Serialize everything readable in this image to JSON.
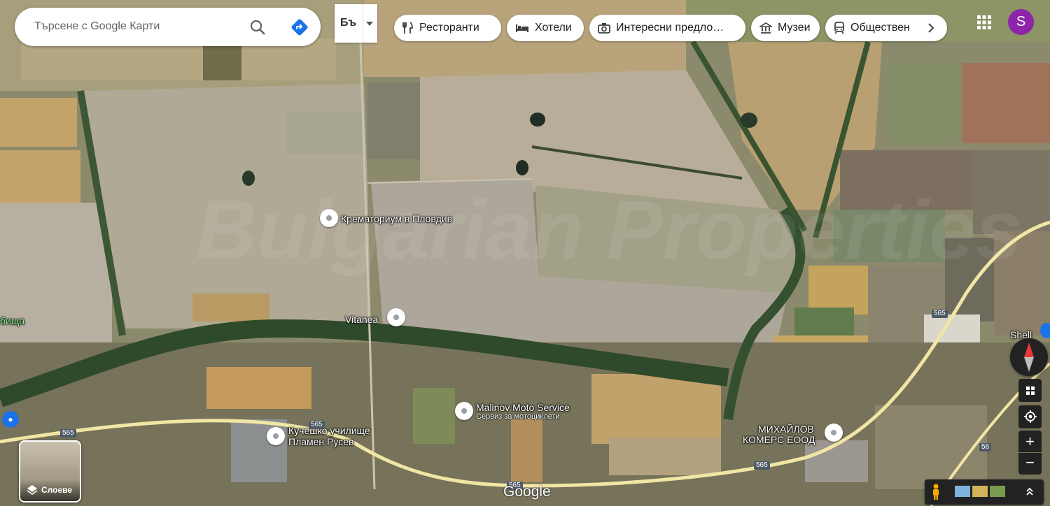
{
  "search": {
    "placeholder": "Търсене с Google Карти"
  },
  "language_button": {
    "label": "Бъ"
  },
  "categories": [
    {
      "label": "Ресторанти",
      "icon": "fork-knife-icon"
    },
    {
      "label": "Хотели",
      "icon": "bed-icon"
    },
    {
      "label": "Интересни предло…",
      "icon": "camera-icon"
    },
    {
      "label": "Музеи",
      "icon": "museum-icon"
    },
    {
      "label": "Обществен",
      "icon": "train-icon"
    }
  ],
  "account": {
    "initial": "S",
    "color": "#8e24aa"
  },
  "places": [
    {
      "name": "Крематориум в Пловдив"
    },
    {
      "name": "Vitanea"
    },
    {
      "name": "Malinov Moto Service",
      "sub": "Сервиз за мотоциклети"
    },
    {
      "name": "Кучешко училище",
      "name2": "Пламен Русев"
    },
    {
      "name": "МИХАЙЛОВ",
      "name2": "КОМЕРС ЕООД"
    },
    {
      "name": "Shell"
    }
  ],
  "partial_label": "бища",
  "road_numbers": [
    "565",
    "565",
    "565",
    "565",
    "565",
    "56"
  ],
  "layers": {
    "label": "Слоеве"
  },
  "branding": "Google",
  "watermark": "Bulgarian Properties"
}
